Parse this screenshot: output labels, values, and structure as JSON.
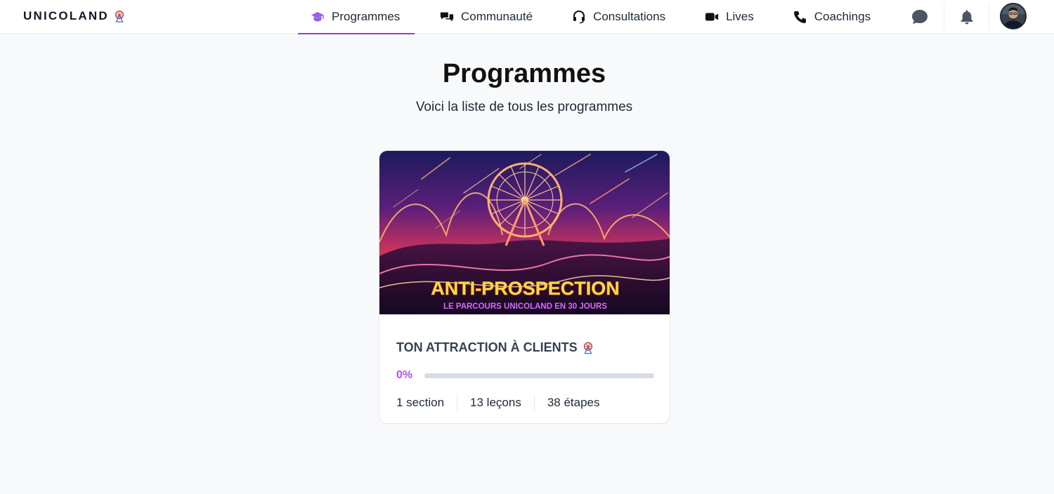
{
  "brand": {
    "name": "UNICOLAND",
    "icon": "ferris-wheel-icon"
  },
  "nav": {
    "items": [
      {
        "label": "Programmes",
        "icon": "graduation-cap-icon",
        "active": true
      },
      {
        "label": "Communauté",
        "icon": "chat-bubbles-icon",
        "active": false
      },
      {
        "label": "Consultations",
        "icon": "headset-icon",
        "active": false
      },
      {
        "label": "Lives",
        "icon": "video-camera-icon",
        "active": false
      },
      {
        "label": "Coachings",
        "icon": "phone-icon",
        "active": false
      }
    ],
    "actions": [
      "chat-icon",
      "bell-icon",
      "avatar"
    ]
  },
  "page": {
    "title": "Programmes",
    "subtitle": "Voici la liste de tous les programmes"
  },
  "program": {
    "cover": {
      "headline": "ANTI-PROSPECTION",
      "tagline": "LE PARCOURS UNICOLAND EN 30 JOURS"
    },
    "title": "TON ATTRACTION À CLIENTS",
    "progress_label": "0%",
    "progress_fraction": 0,
    "sections": "1 section",
    "lessons": "13 leçons",
    "steps": "38 étapes"
  },
  "colors": {
    "accent": "#a855f7",
    "active_underline": "#8b3fe0",
    "background": "#f8f9fb",
    "cover_headline": "#ffd84a",
    "cover_tagline": "#d66bff"
  }
}
